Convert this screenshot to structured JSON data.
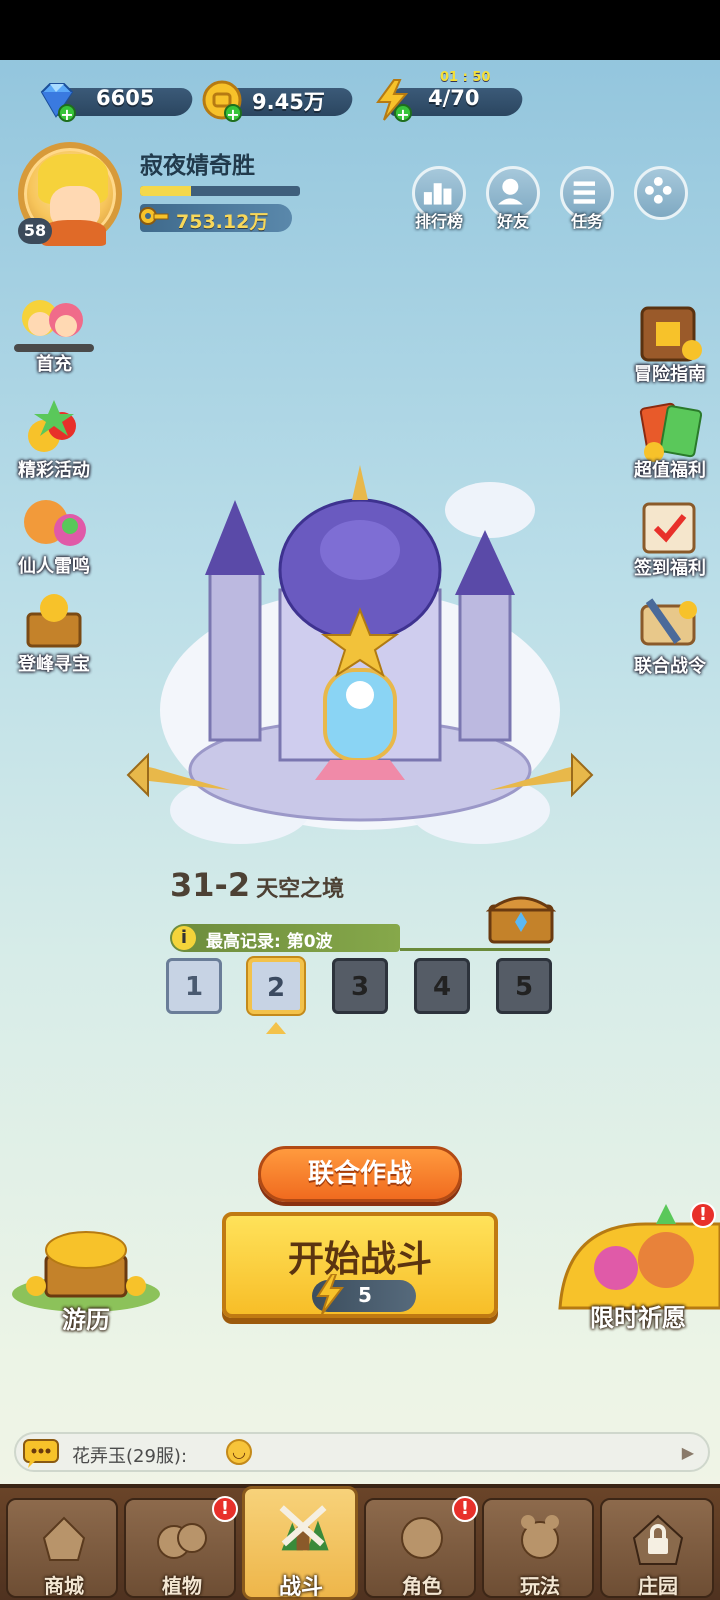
{
  "resources": {
    "gems": "6605",
    "gold": "9.45万",
    "energy": "4/70",
    "energy_timer": "01 : 50"
  },
  "profile": {
    "name": "寂夜婧奇胜",
    "level": "58",
    "power": "753.12万",
    "xp_progress": 0.32
  },
  "top_buttons": [
    {
      "label": "排行榜",
      "icon": "leaderboard-icon"
    },
    {
      "label": "好友",
      "icon": "friends-icon"
    },
    {
      "label": "任务",
      "icon": "tasks-icon"
    },
    {
      "label": "",
      "icon": "menu-icon"
    }
  ],
  "left_menu": [
    {
      "label": "首充"
    },
    {
      "label": "精彩活动"
    },
    {
      "label": "仙人雷鸣"
    },
    {
      "label": "登峰寻宝"
    }
  ],
  "right_menu": [
    {
      "label": "冒险指南"
    },
    {
      "label": "超值福利"
    },
    {
      "label": "签到福利"
    },
    {
      "label": "联合战令"
    }
  ],
  "stage": {
    "number": "31-2",
    "name": "天空之境",
    "record": "最高记录: 第0波",
    "waves": [
      "1",
      "2",
      "3",
      "4",
      "5"
    ],
    "current_wave": 2
  },
  "buttons": {
    "coop": "联合作战",
    "start": "开始战斗",
    "start_cost": "5",
    "travel": "游历",
    "wish": "限时祈愿"
  },
  "chat": {
    "message": "花弄玉(29服):"
  },
  "nav": [
    {
      "label": "商城",
      "badge": false
    },
    {
      "label": "植物",
      "badge": true
    },
    {
      "label": "战斗",
      "badge": false,
      "active": true
    },
    {
      "label": "角色",
      "badge": true
    },
    {
      "label": "玩法",
      "badge": false
    },
    {
      "label": "庄园",
      "badge": false,
      "locked": true
    }
  ],
  "colors": {
    "accent_gold": "#f7be28",
    "accent_orange": "#f06b1f",
    "nav_brown": "#4f3220",
    "sky": "#b9dde8"
  }
}
